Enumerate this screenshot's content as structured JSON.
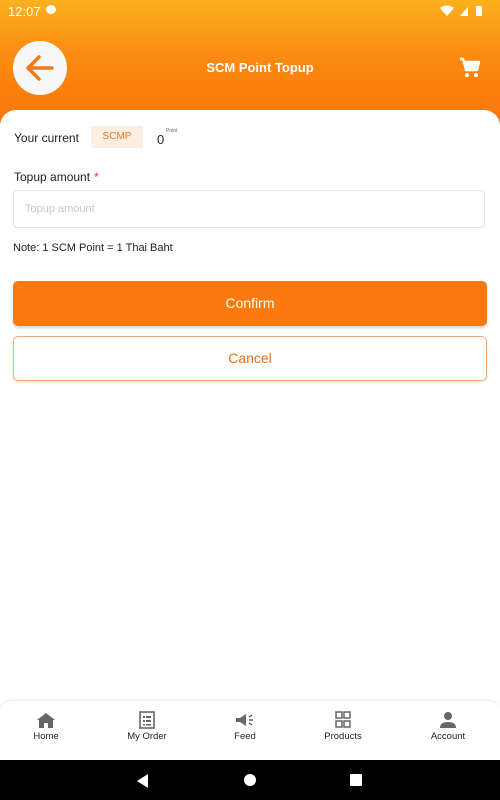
{
  "status": {
    "time": "12:07",
    "icons_right": [
      "wifi-icon",
      "signal-icon",
      "battery-icon"
    ]
  },
  "header": {
    "title": "SCM Point Topup",
    "back_icon": "arrow-left-icon",
    "cart_icon": "cart-icon"
  },
  "balance": {
    "label": "Your current",
    "chip": "SCMP",
    "value": "0",
    "unit": "Point"
  },
  "topup": {
    "label": "Topup amount",
    "required_mark": "*",
    "value": "",
    "placeholder": "Topup amount"
  },
  "note": "Note: 1 SCM Point = 1 Thai Baht",
  "buttons": {
    "confirm": "Confirm",
    "cancel": "Cancel"
  },
  "nav": {
    "items": [
      {
        "label": "Home",
        "icon": "home-icon"
      },
      {
        "label": "My Order",
        "icon": "order-list-icon"
      },
      {
        "label": "Feed",
        "icon": "megaphone-icon"
      },
      {
        "label": "Products",
        "icon": "grid-icon"
      },
      {
        "label": "Account",
        "icon": "person-icon"
      }
    ]
  },
  "colors": {
    "primary": "#fb7a10",
    "header_top": "#fbb11f",
    "chip_bg": "#fdeee2",
    "required": "#e53935"
  }
}
